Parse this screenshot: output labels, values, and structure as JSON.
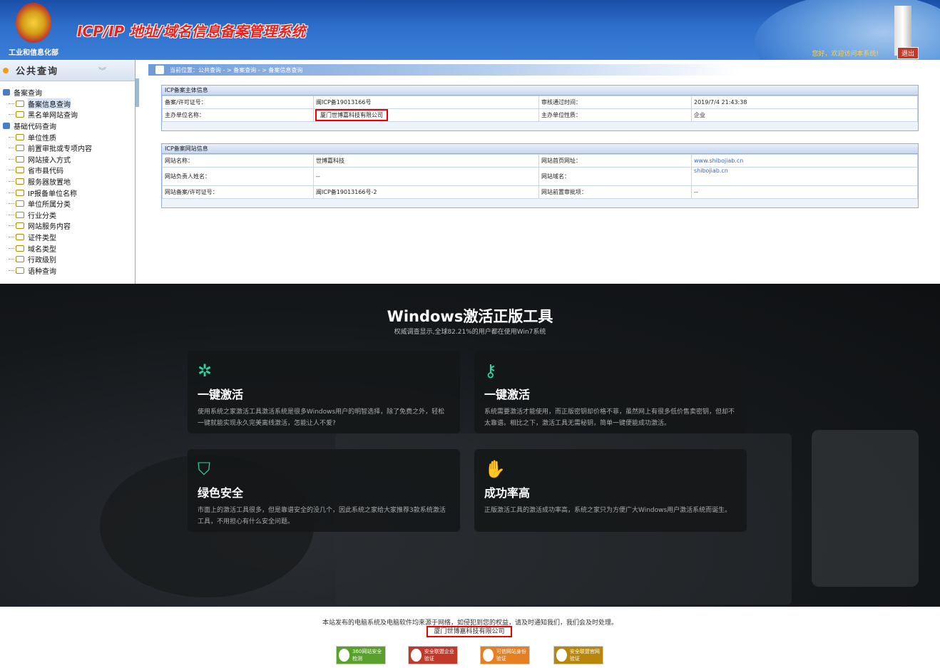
{
  "header": {
    "dept_name": "工业和信息化部",
    "system_title": "ICP/IP 地址/域名信息备案管理系统",
    "welcome": "您好，欢迎访问本系统!",
    "logout": "退出"
  },
  "sidebar": {
    "title": "公共查询",
    "items": [
      {
        "label": "备案查询",
        "group": true
      },
      {
        "label": "备案信息查询",
        "group": false,
        "selected": true
      },
      {
        "label": "黑名单网站查询",
        "group": false
      },
      {
        "label": "基础代码查询",
        "group": true
      },
      {
        "label": "单位性质",
        "group": false
      },
      {
        "label": "前置审批或专项内容",
        "group": false
      },
      {
        "label": "网站接入方式",
        "group": false
      },
      {
        "label": "省市县代码",
        "group": false
      },
      {
        "label": "服务器放置地",
        "group": false
      },
      {
        "label": "IP报备单位名称",
        "group": false
      },
      {
        "label": "单位所属分类",
        "group": false
      },
      {
        "label": "行业分类",
        "group": false
      },
      {
        "label": "网站服务内容",
        "group": false
      },
      {
        "label": "证件类型",
        "group": false
      },
      {
        "label": "域名类型",
        "group": false
      },
      {
        "label": "行政级别",
        "group": false
      },
      {
        "label": "语种查询",
        "group": false
      }
    ]
  },
  "breadcrumb": "当前位置：公共查询 - > 备案查询 - > 备案信息查询",
  "subject_panel": {
    "title": "ICP备案主体信息",
    "rows": [
      [
        "备案/许可证号：",
        "闽ICP备19013166号",
        "审核通过时间：",
        "2019/7/4 21:43:38"
      ],
      [
        "主办单位名称：",
        "厦门世博嘉科技有限公司",
        "主办单位性质：",
        "企业"
      ]
    ]
  },
  "website_panel": {
    "title": "ICP备案网站信息",
    "rows": [
      [
        "网站名称：",
        "世博嘉科技",
        "网站首页网址：",
        "www.shibojiab.cn"
      ],
      [
        "网站负责人姓名：",
        "--",
        "网站域名：",
        "shibojiab.cn"
      ],
      [
        "网站备案/许可证号：",
        "闽ICP备19013166号-2",
        "网站前置审批项：",
        "--"
      ]
    ]
  },
  "promo": {
    "title": "Windows激活正版工具",
    "subtitle": "权威调查显示,全球82.21%的用户都在使用Win7系统",
    "cards": [
      {
        "icon": "click-icon",
        "title": "一键激活",
        "desc": "使用系统之家激活工具激活系统是很多Windows用户的明智选择，除了免费之外，轻松一键就能实现永久完美离线激活，怎能让人不爱?"
      },
      {
        "icon": "key-icon",
        "title": "一键激活",
        "desc": "系统需要激活才能使用，而正版密钥却价格不菲，虽然网上有很多低价售卖密钥，但却不太靠谱。相比之下，激活工具无需秘钥，简单一键便能成功激活。"
      },
      {
        "icon": "shield-icon",
        "title": "绿色安全",
        "desc": "市面上的激活工具很多，但是靠谱安全的没几个，因此系统之家给大家推荐3款系统激活工具，不用担心有什么安全问题。"
      },
      {
        "icon": "thumbs-up-icon",
        "title": "成功率高",
        "desc": "正版激活工具的激活成功率高，系统之家只为方便广大Windows用户激活系统而诞生。"
      }
    ]
  },
  "footer": {
    "notice": "本站发布的电脑系统及电脑软件均来源于网络，如侵犯到您的权益，请及时通知我们，我们会及时处理。",
    "company": "厦门世博嘉科技有限公司",
    "badges": [
      {
        "label": "360网站安全检测",
        "color": "#5aa02c"
      },
      {
        "label": "安全联盟企业验证",
        "color": "#c0392b"
      },
      {
        "label": "可信网站身份验证",
        "color": "#e67e22"
      },
      {
        "label": "安全联盟官网验证",
        "color": "#b8860b"
      }
    ]
  }
}
